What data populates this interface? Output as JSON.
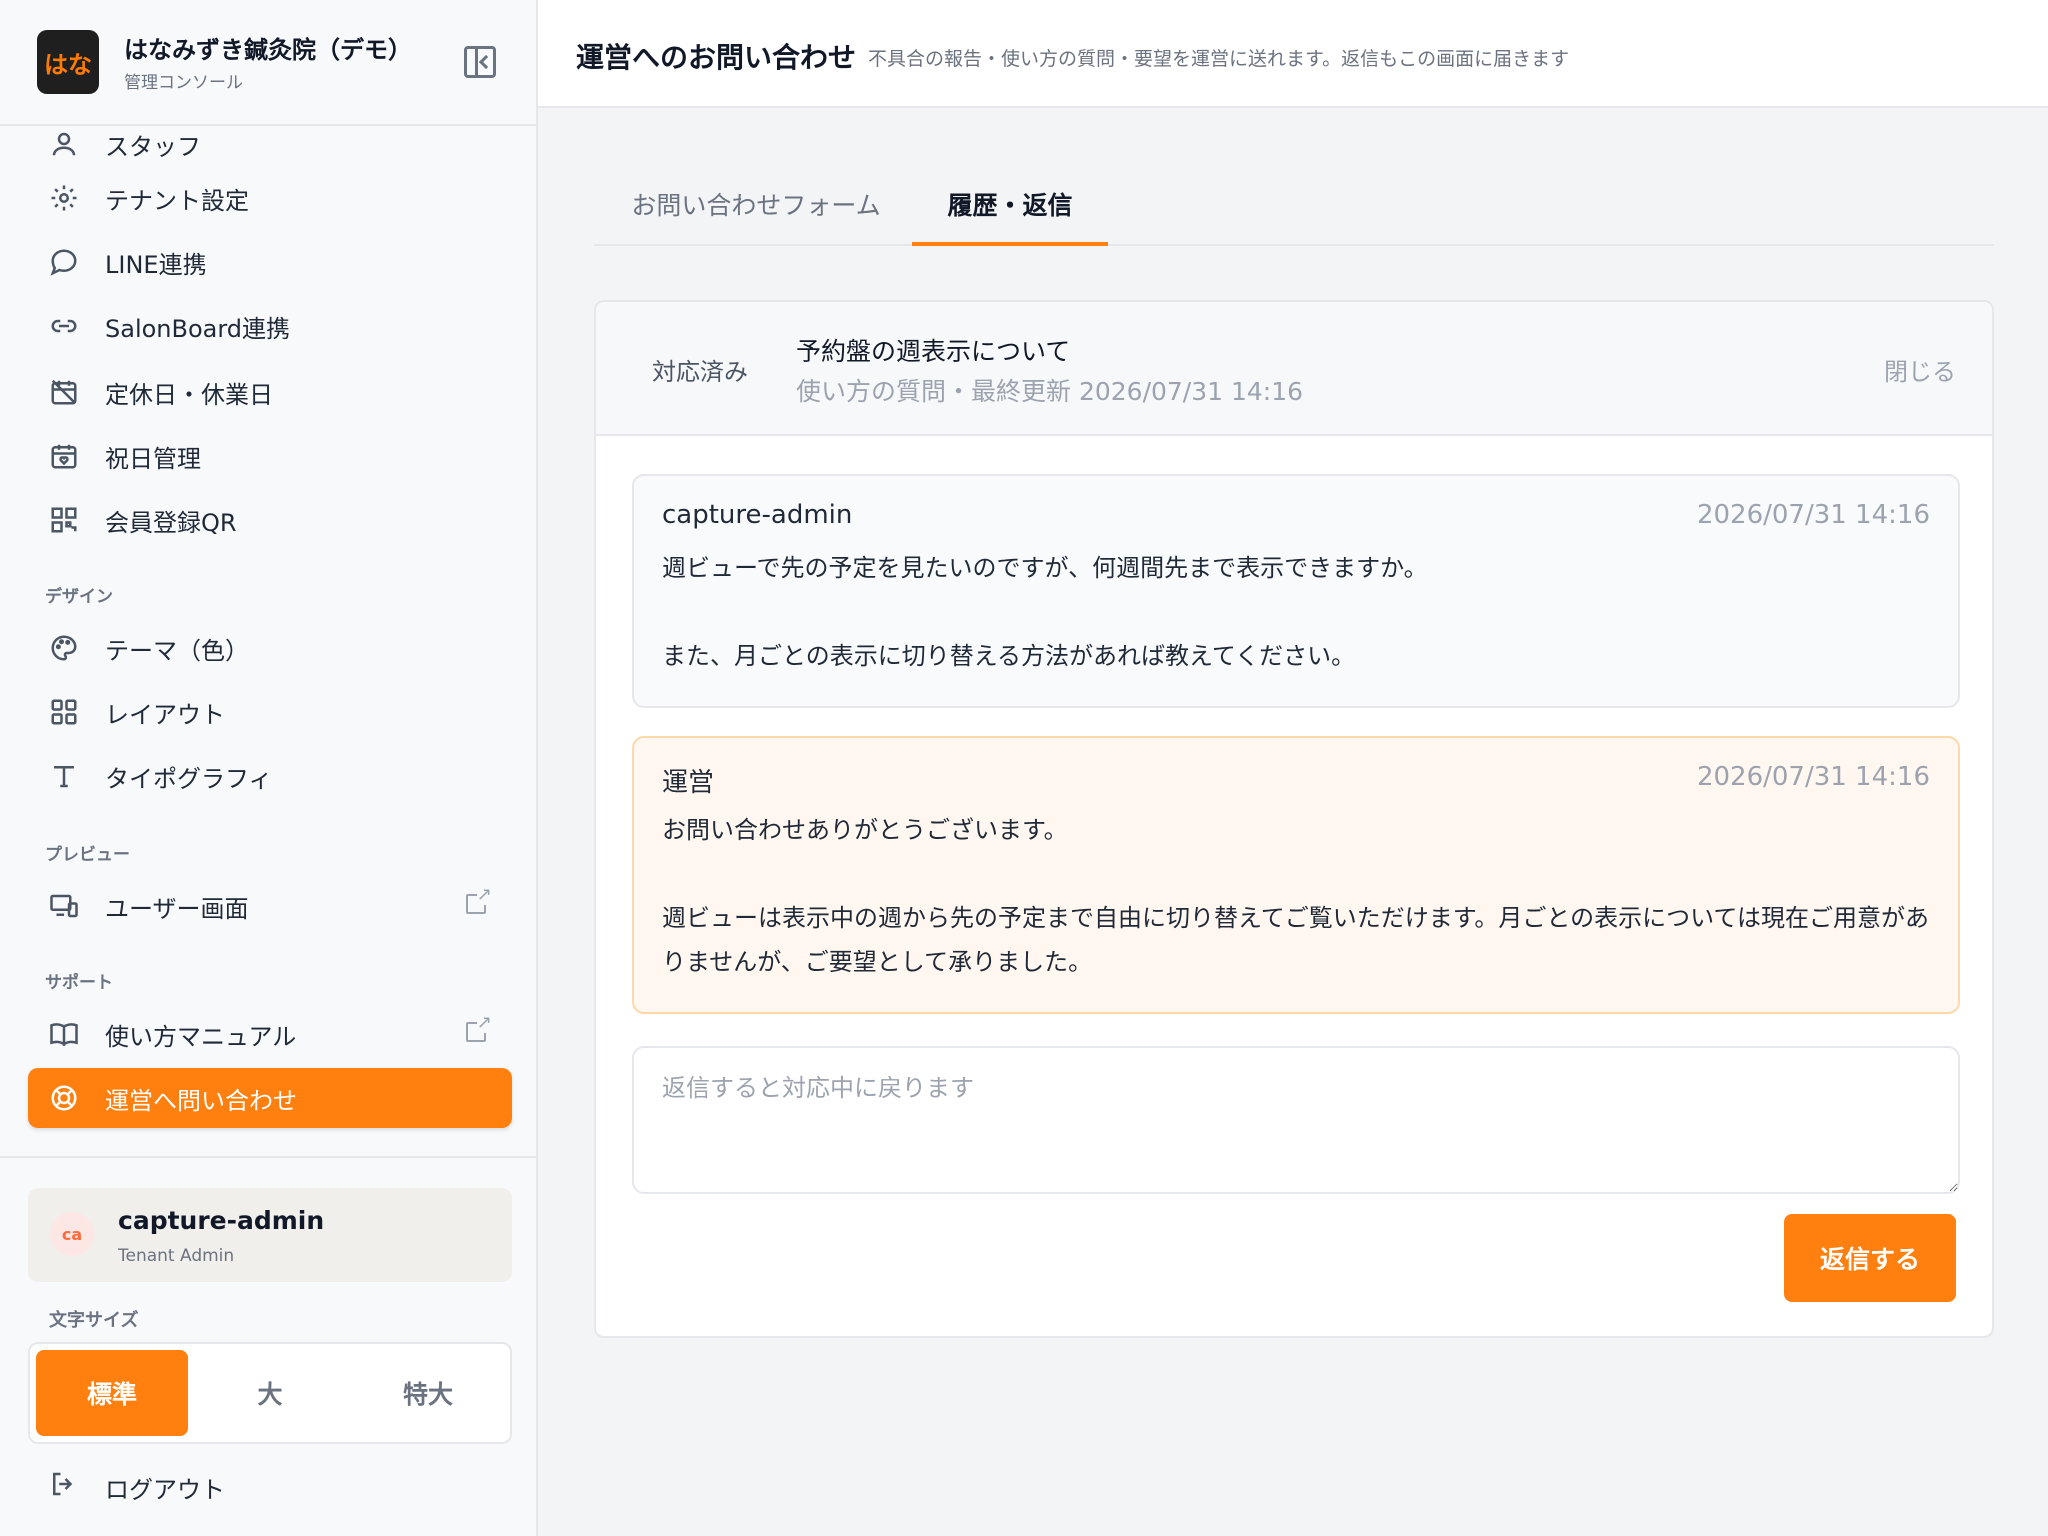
{
  "app": {
    "name": "はなみずき鍼灸院（デモ）",
    "subtitle": "管理コンソール",
    "logo_text": "はな",
    "accent_color": "#ff7f0f"
  },
  "sidebar": {
    "items_top": [
      {
        "label": "スタッフ",
        "icon": "user-icon"
      },
      {
        "label": "テナント設定",
        "icon": "gear-icon"
      },
      {
        "label": "LINE連携",
        "icon": "chat-bubble-icon"
      },
      {
        "label": "SalonBoard連携",
        "icon": "link-icon"
      },
      {
        "label": "定休日・休業日",
        "icon": "calendar-off-icon"
      },
      {
        "label": "祝日管理",
        "icon": "calendar-heart-icon"
      },
      {
        "label": "会員登録QR",
        "icon": "qr-code-icon"
      }
    ],
    "section_design": "デザイン",
    "items_design": [
      {
        "label": "テーマ（色）",
        "icon": "palette-icon"
      },
      {
        "label": "レイアウト",
        "icon": "grid-icon"
      },
      {
        "label": "タイポグラフィ",
        "icon": "type-icon"
      }
    ],
    "section_preview": "プレビュー",
    "items_preview": [
      {
        "label": "ユーザー画面",
        "icon": "device-icon"
      }
    ],
    "section_support": "サポート",
    "items_support": [
      {
        "label": "使い方マニュアル",
        "icon": "book-icon"
      },
      {
        "label": "運営へ問い合わせ",
        "icon": "lifebuoy-icon"
      }
    ],
    "user": {
      "initials": "ca",
      "name": "capture-admin",
      "role": "Tenant Admin"
    },
    "font_size_label": "文字サイズ",
    "font_size_options": [
      "標準",
      "大",
      "特大"
    ],
    "font_size_selected": "標準",
    "logout_label": "ログアウト"
  },
  "header": {
    "title": "運営へのお問い合わせ",
    "subtitle": "不具合の報告・使い方の質問・要望を運営に送れます。返信もこの画面に届きます"
  },
  "tabs": [
    {
      "label": "お問い合わせフォーム",
      "active": false
    },
    {
      "label": "履歴・返信",
      "active": true
    }
  ],
  "ticket": {
    "status": "対応済み",
    "subject": "予約盤の週表示について",
    "meta": "使い方の質問・最終更新 2026/07/31 14:16",
    "close_label": "閉じる",
    "messages": [
      {
        "author": "capture-admin",
        "time": "2026/07/31 14:16",
        "lines": [
          "週ビューで先の予定を見たいのですが、何週間先まで表示できますか。",
          "",
          "また、月ごとの表示に切り替える方法があれば教えてください。"
        ]
      },
      {
        "author": "運営",
        "time": "2026/07/31 14:16",
        "lines": [
          "お問い合わせありがとうございます。",
          "",
          "週ビューは表示中の週から先の予定まで自由に切り替えてご覧いただけます。月ごとの表示については現在ご用意がありませんが、ご要望として承りました。"
        ]
      }
    ],
    "reply_placeholder": "返信すると対応中に戻ります",
    "reply_value": "",
    "send_label": "返信する"
  }
}
